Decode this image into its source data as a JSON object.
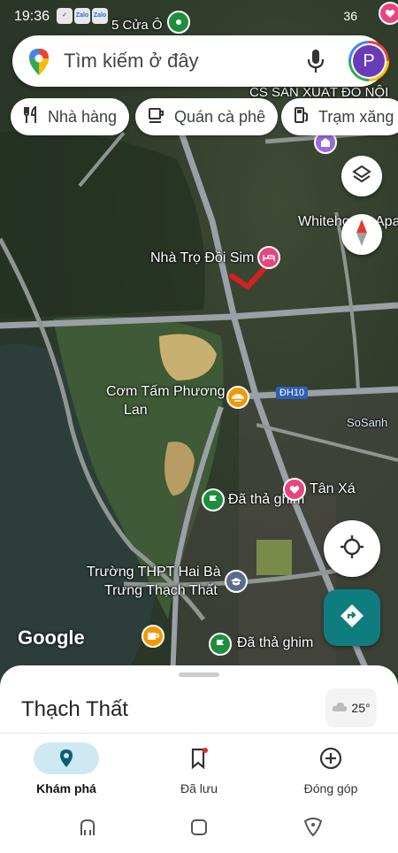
{
  "status_bar": {
    "time": "19:36",
    "mini_app_1": "Zalo",
    "mini_app_2": "Zalo",
    "map_top_label": "5 Cửa Ô",
    "battery": "36"
  },
  "search": {
    "placeholder": "Tìm kiếm ở đây",
    "avatar_letter": "P"
  },
  "chips": [
    {
      "label": "Nhà hàng",
      "icon": "fork-knife-icon"
    },
    {
      "label": "Quán cà phê",
      "icon": "coffee-cup-icon"
    },
    {
      "label": "Trạm xăng",
      "icon": "gas-station-icon"
    }
  ],
  "map": {
    "labels": {
      "cs_san_xuat": "CS SẢN XUẤT ĐỒ NỘI",
      "whitehouse": "Whiteho",
      "apa": "Apa",
      "nha_tro": "Nhà Trọ Đồi Sim",
      "com_tam_1": "Cơm Tấm Phương",
      "com_tam_2": "Lan",
      "road_dh10": "ĐH10",
      "tan_xa": "Tân Xá",
      "da_tha_ghim_1": "Đã thả ghim",
      "truong_1": "Trường THPT Hai Bà",
      "truong_2": "Trưng Thạch Thất",
      "da_tha_ghim_2": "Đã thả ghim",
      "sosanh": "SoSanh",
      "google": "Google"
    },
    "colors": {
      "pink_pin": "#e8457e",
      "green_pin": "#1e8e3e",
      "orange_pin": "#f29900",
      "blue_pin": "#5b6b8c",
      "road": "#9aa0a6",
      "water": "#2c3d3a",
      "teal_fab": "#0f7d80"
    }
  },
  "bottom_sheet": {
    "place": "Thạch Thất",
    "weather": "25°"
  },
  "nav": [
    {
      "label": "Khám phá",
      "icon": "location-pin-icon",
      "active": true
    },
    {
      "label": "Đã lưu",
      "icon": "bookmark-icon",
      "active": false
    },
    {
      "label": "Đóng góp",
      "icon": "add-circle-icon",
      "active": false
    }
  ]
}
